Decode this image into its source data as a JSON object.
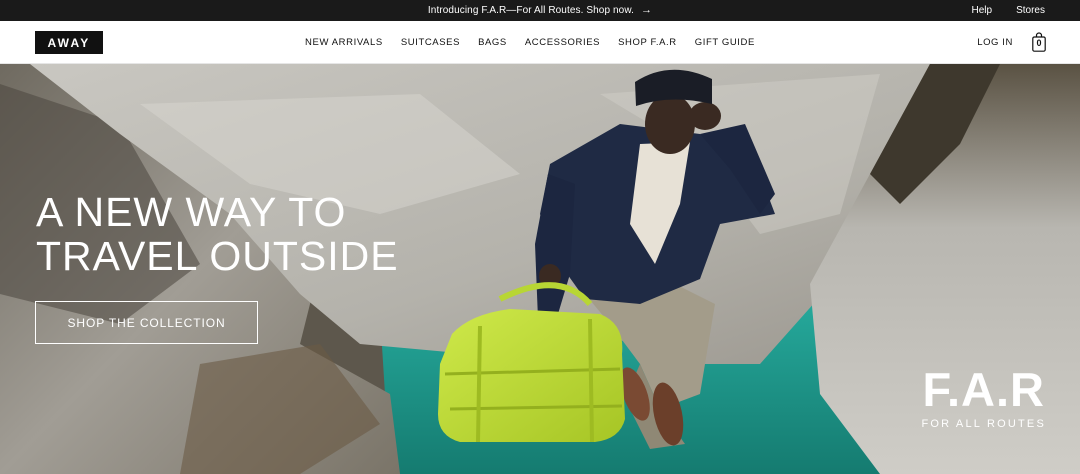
{
  "announcement": {
    "promo_text": "Introducing F.A.R—For All Routes. Shop now.",
    "arrow_glyph": "→",
    "help_label": "Help",
    "stores_label": "Stores"
  },
  "header": {
    "logo_text": "AWAY",
    "nav": [
      {
        "label": "NEW ARRIVALS"
      },
      {
        "label": "SUITCASES"
      },
      {
        "label": "BAGS"
      },
      {
        "label": "ACCESSORIES"
      },
      {
        "label": "SHOP F.A.R"
      },
      {
        "label": "GIFT GUIDE"
      }
    ],
    "login_label": "LOG IN",
    "cart_count": "0",
    "cart_icon": "shopping-bag-icon"
  },
  "hero": {
    "headline_line1": "A NEW WAY TO",
    "headline_line2": "TRAVEL OUTSIDE",
    "cta_label": "SHOP THE COLLECTION",
    "brand_mark": "F.A.R",
    "brand_sub": "FOR ALL ROUTES"
  },
  "colors": {
    "announcement_bg": "#1a1a1a",
    "water": "#1f9c90",
    "bag": "#b8d634",
    "jacket": "#1f2a44"
  }
}
